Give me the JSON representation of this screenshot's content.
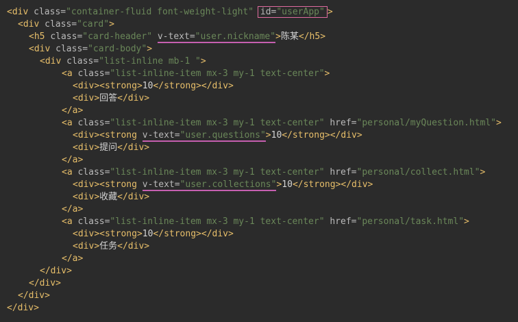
{
  "editor": {
    "lines": [
      {
        "indent": 0,
        "code": "<div class=\"container-fluid font-weight-light\" id=\"userApp\">"
      },
      {
        "indent": 2,
        "code": "<div class=\"card\">"
      },
      {
        "indent": 4,
        "code": "<h5 class=\"card-header\" v-text=\"user.nickname\">陈某</h5>"
      },
      {
        "indent": 4,
        "code": "<div class=\"card-body\">"
      },
      {
        "indent": 6,
        "code": "<div class=\"list-inline mb-1 \">"
      },
      {
        "indent": 10,
        "code": "<a class=\"list-inline-item mx-3 my-1 text-center\">"
      },
      {
        "indent": 12,
        "code": "<div><strong>10</strong></div>"
      },
      {
        "indent": 12,
        "code": "<div>回答</div>"
      },
      {
        "indent": 10,
        "code": "</a>"
      },
      {
        "indent": 10,
        "code": "<a class=\"list-inline-item mx-3 my-1 text-center\" href=\"personal/myQuestion.html\">"
      },
      {
        "indent": 12,
        "code": "<div><strong v-text=\"user.questions\">10</strong></div>"
      },
      {
        "indent": 12,
        "code": "<div>提问</div>"
      },
      {
        "indent": 10,
        "code": "</a>"
      },
      {
        "indent": 10,
        "code": "<a class=\"list-inline-item mx-3 my-1 text-center\" href=\"personal/collect.html\">"
      },
      {
        "indent": 12,
        "code": "<div><strong v-text=\"user.collections\">10</strong></div>"
      },
      {
        "indent": 12,
        "code": "<div>收藏</div>"
      },
      {
        "indent": 10,
        "code": "</a>"
      },
      {
        "indent": 10,
        "code": "<a class=\"list-inline-item mx-3 my-1 text-center\" href=\"personal/task.html\">"
      },
      {
        "indent": 12,
        "code": "<div><strong>10</strong></div>"
      },
      {
        "indent": 12,
        "code": "<div>任务</div>"
      },
      {
        "indent": 10,
        "code": "</a>"
      },
      {
        "indent": 6,
        "code": "</div>"
      },
      {
        "indent": 4,
        "code": "</div>"
      },
      {
        "indent": 2,
        "code": "</div>"
      },
      {
        "indent": 0,
        "code": "</div>"
      }
    ],
    "highlights": {
      "boxed": [
        "id=\"userApp\""
      ],
      "underlined": [
        "v-text=\"user.nickname\"",
        "v-text=\"user.questions\"",
        "v-text=\"user.collections\""
      ]
    },
    "colors": {
      "background": "#2b2b2b",
      "tag": "#e8bf6a",
      "attribute": "#bababa",
      "string": "#6a8759",
      "text": "#d4d4d4",
      "box_outline": "#e06c9f",
      "underline": "#c65fb0"
    }
  }
}
